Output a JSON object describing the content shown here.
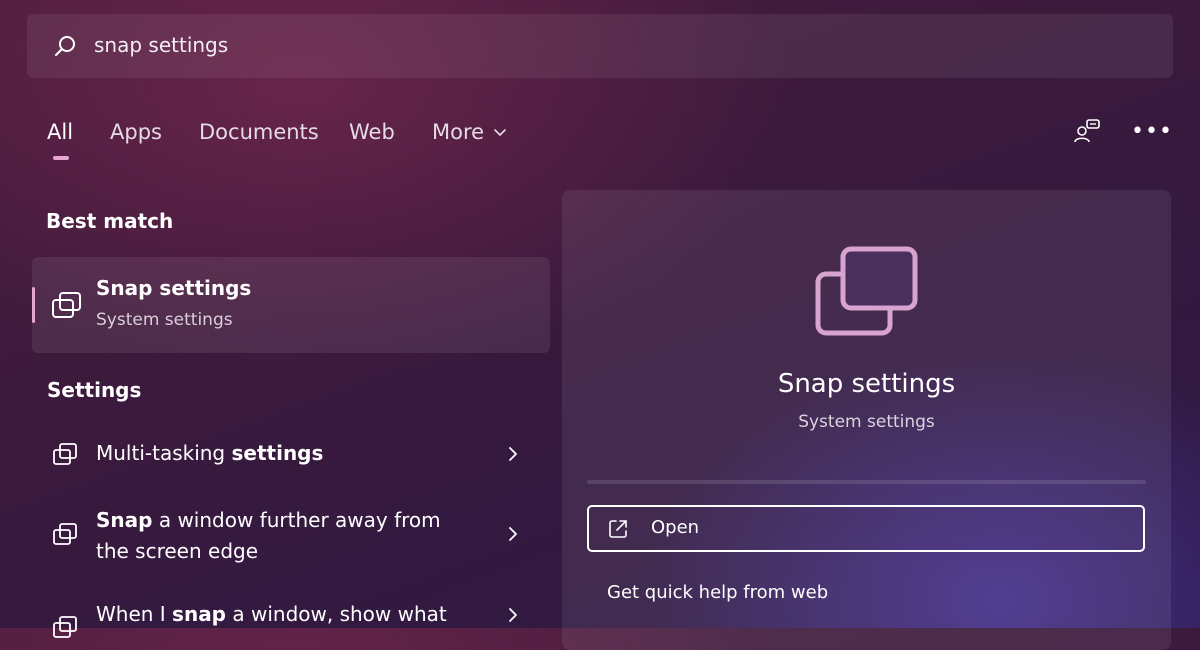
{
  "search": {
    "query": "snap settings"
  },
  "tabs": [
    {
      "label": "All",
      "active": true
    },
    {
      "label": "Apps"
    },
    {
      "label": "Documents"
    },
    {
      "label": "Web"
    },
    {
      "label": "More"
    }
  ],
  "header_icons": {
    "people": "people-icon",
    "more": "more-options-icon"
  },
  "best_match": {
    "section_title": "Best match",
    "title": "Snap settings",
    "subtitle": "System settings",
    "icon": "snap-window-icon"
  },
  "settings": {
    "section_title": "Settings",
    "items": [
      {
        "parts": [
          {
            "text": "Multi-tasking ",
            "bold": false
          },
          {
            "text": "settings",
            "bold": true
          }
        ]
      },
      {
        "parts": [
          {
            "text": "Snap",
            "bold": true
          },
          {
            "text": " a window further away from the screen edge",
            "bold": false
          }
        ]
      },
      {
        "parts": [
          {
            "text": "When I ",
            "bold": false
          },
          {
            "text": "snap",
            "bold": true
          },
          {
            "text": " a window, show what",
            "bold": false
          }
        ]
      }
    ]
  },
  "preview": {
    "title": "Snap settings",
    "subtitle": "System settings",
    "open_label": "Open",
    "help_label": "Get quick help from web"
  },
  "colors": {
    "accent": "#e6a5d2",
    "icon_pink": "#d9a3d0"
  }
}
